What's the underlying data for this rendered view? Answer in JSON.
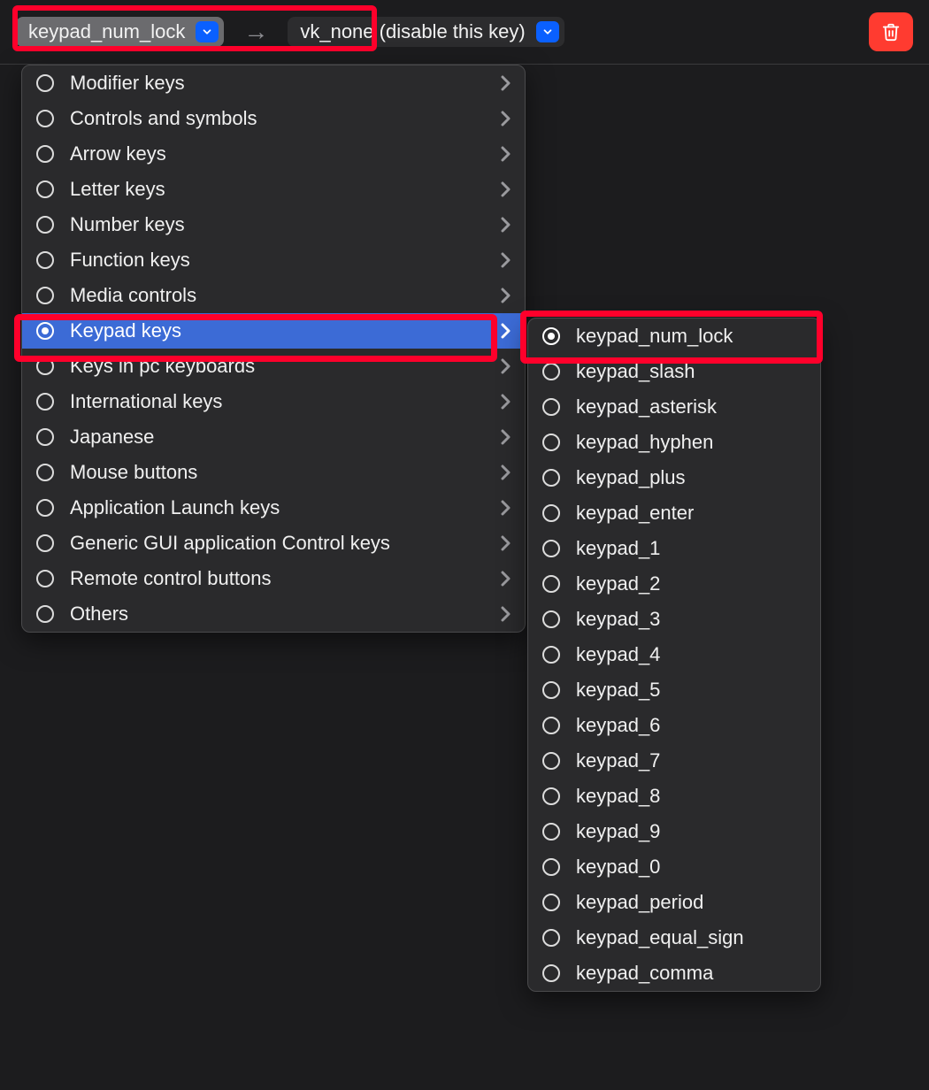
{
  "toolbar": {
    "from_value": "keypad_num_lock",
    "arrow": "→",
    "to_value": "vk_none (disable this key)"
  },
  "categories": [
    {
      "label": "Modifier keys",
      "selected": false,
      "active": false
    },
    {
      "label": "Controls and symbols",
      "selected": false,
      "active": false
    },
    {
      "label": "Arrow keys",
      "selected": false,
      "active": false
    },
    {
      "label": "Letter keys",
      "selected": false,
      "active": false
    },
    {
      "label": "Number keys",
      "selected": false,
      "active": false
    },
    {
      "label": "Function keys",
      "selected": false,
      "active": false
    },
    {
      "label": "Media controls",
      "selected": false,
      "active": false
    },
    {
      "label": "Keypad keys",
      "selected": true,
      "active": true
    },
    {
      "label": "Keys in pc keyboards",
      "selected": false,
      "active": false
    },
    {
      "label": "International keys",
      "selected": false,
      "active": false
    },
    {
      "label": "Japanese",
      "selected": false,
      "active": false
    },
    {
      "label": "Mouse buttons",
      "selected": false,
      "active": false
    },
    {
      "label": "Application Launch keys",
      "selected": false,
      "active": false
    },
    {
      "label": "Generic GUI application Control keys",
      "selected": false,
      "active": false
    },
    {
      "label": "Remote control buttons",
      "selected": false,
      "active": false
    },
    {
      "label": "Others",
      "selected": false,
      "active": false
    }
  ],
  "sub_items": [
    {
      "label": "keypad_num_lock",
      "selected": true
    },
    {
      "label": "keypad_slash",
      "selected": false
    },
    {
      "label": "keypad_asterisk",
      "selected": false
    },
    {
      "label": "keypad_hyphen",
      "selected": false
    },
    {
      "label": "keypad_plus",
      "selected": false
    },
    {
      "label": "keypad_enter",
      "selected": false
    },
    {
      "label": "keypad_1",
      "selected": false
    },
    {
      "label": "keypad_2",
      "selected": false
    },
    {
      "label": "keypad_3",
      "selected": false
    },
    {
      "label": "keypad_4",
      "selected": false
    },
    {
      "label": "keypad_5",
      "selected": false
    },
    {
      "label": "keypad_6",
      "selected": false
    },
    {
      "label": "keypad_7",
      "selected": false
    },
    {
      "label": "keypad_8",
      "selected": false
    },
    {
      "label": "keypad_9",
      "selected": false
    },
    {
      "label": "keypad_0",
      "selected": false
    },
    {
      "label": "keypad_period",
      "selected": false
    },
    {
      "label": "keypad_equal_sign",
      "selected": false
    },
    {
      "label": "keypad_comma",
      "selected": false
    }
  ]
}
